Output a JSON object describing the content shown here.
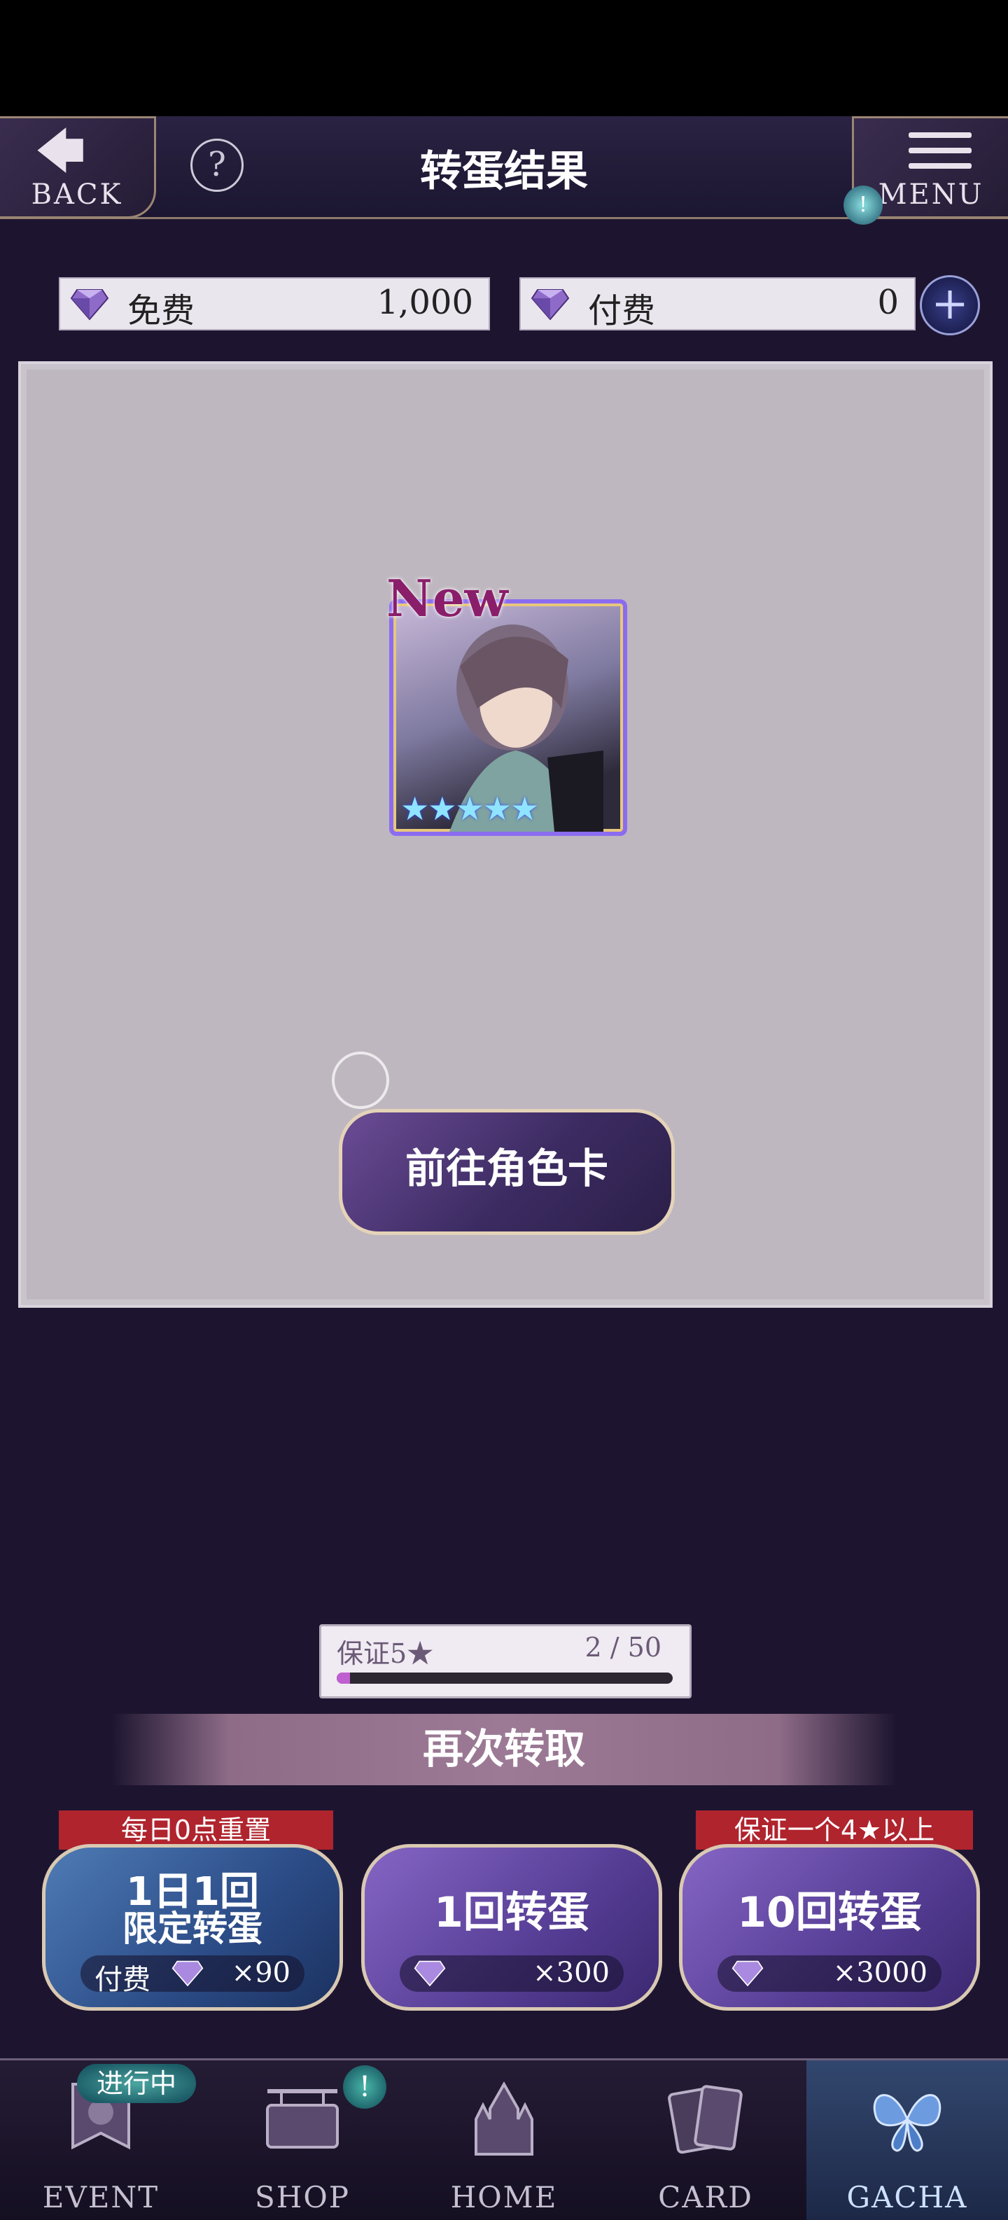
{
  "header": {
    "title": "转蛋结果",
    "back_label": "BACK",
    "menu_label": "MENU",
    "help_icon": "?",
    "menu_badge": "!"
  },
  "currency": {
    "free_label": "免费",
    "free_value": "1,000",
    "paid_label": "付费",
    "paid_value": "0",
    "add_icon": "+"
  },
  "result": {
    "new_badge": "New",
    "card_stars": "★★★★★",
    "star_count": 5,
    "goto_card_label": "前往角色卡"
  },
  "guarantee": {
    "label": "保证5★",
    "count": "2 / 50",
    "progress_fraction": 0.04
  },
  "again": {
    "label": "再次转取"
  },
  "gacha_options": [
    {
      "ribbon": "每日0点重置",
      "title_line1": "1日1回",
      "title_line2": "限定转蛋",
      "price_label": "付费",
      "price": "×90"
    },
    {
      "title": "1回转蛋",
      "price": "×300"
    },
    {
      "ribbon": "保证一个4★以上",
      "title": "10回转蛋",
      "price": "×3000"
    }
  ],
  "nav": {
    "items": [
      {
        "label": "EVENT",
        "badge": "进行中"
      },
      {
        "label": "SHOP",
        "badge": "!"
      },
      {
        "label": "HOME"
      },
      {
        "label": "CARD"
      },
      {
        "label": "GACHA"
      }
    ]
  },
  "colors": {
    "accent_purple": "#553d94",
    "daily_blue": "#2b4b86",
    "ribbon_red": "#b0242e",
    "panel_bg": "#beb7bf"
  }
}
